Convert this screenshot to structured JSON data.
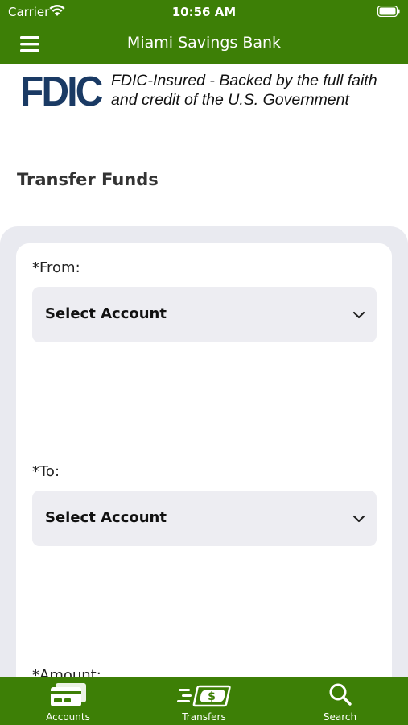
{
  "status_bar": {
    "carrier": "Carrier",
    "time": "10:56 AM"
  },
  "header": {
    "title": "Miami Savings Bank",
    "menu_icon": "hamburger-menu-icon"
  },
  "fdic": {
    "logo_text": "FDIC",
    "notice_line1": "FDIC-Insured - Backed by the full faith",
    "notice_line2": "and credit of the U.S. Government"
  },
  "page": {
    "title": "Transfer Funds"
  },
  "form": {
    "from_label": "*From:",
    "from_value": "Select Account",
    "to_label": "*To:",
    "to_value": "Select Account",
    "amount_label": "*Amount:"
  },
  "tab_bar": {
    "tabs": [
      {
        "label": "Accounts",
        "icon": "accounts-card-icon"
      },
      {
        "label": "Transfers",
        "icon": "transfer-money-icon"
      },
      {
        "label": "Search",
        "icon": "search-icon"
      }
    ]
  },
  "colors": {
    "brand_green": "#3d7f06",
    "fdic_navy": "#1a3a64",
    "form_background": "#e9eaf0",
    "select_background": "#ededf2"
  }
}
